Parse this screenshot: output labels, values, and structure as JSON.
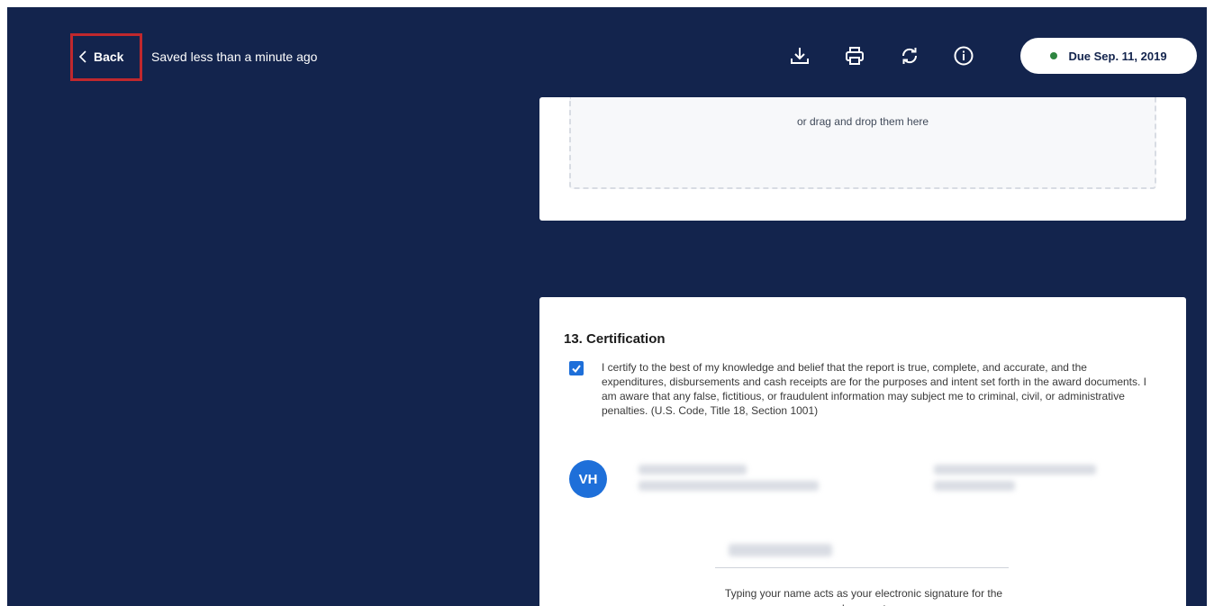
{
  "header": {
    "back_label": "Back",
    "saved_status": "Saved less than a minute ago",
    "due_label": "Due Sep. 11, 2019",
    "due_status_color": "#2e8540",
    "icons": [
      "download-icon",
      "print-icon",
      "refresh-icon",
      "info-icon"
    ]
  },
  "upload": {
    "drop_text": "or drag and drop them here"
  },
  "certification": {
    "title": "13. Certification",
    "checked": true,
    "statement": "I certify to the best of my knowledge and belief that the report is true, complete, and accurate, and the expenditures, disbursements and cash receipts are for the purposes and intent set forth in the award documents. I am aware that any false, fictitious, or fraudulent information may subject me to criminal, civil, or administrative penalties. (U.S. Code, Title 18, Section 1001)",
    "avatar_initials": "VH",
    "signature_note": "Typing your name acts as your electronic signature for the document."
  },
  "colors": {
    "background": "#13244d",
    "accent": "#1e6fd9",
    "highlight": "#c0282d"
  }
}
